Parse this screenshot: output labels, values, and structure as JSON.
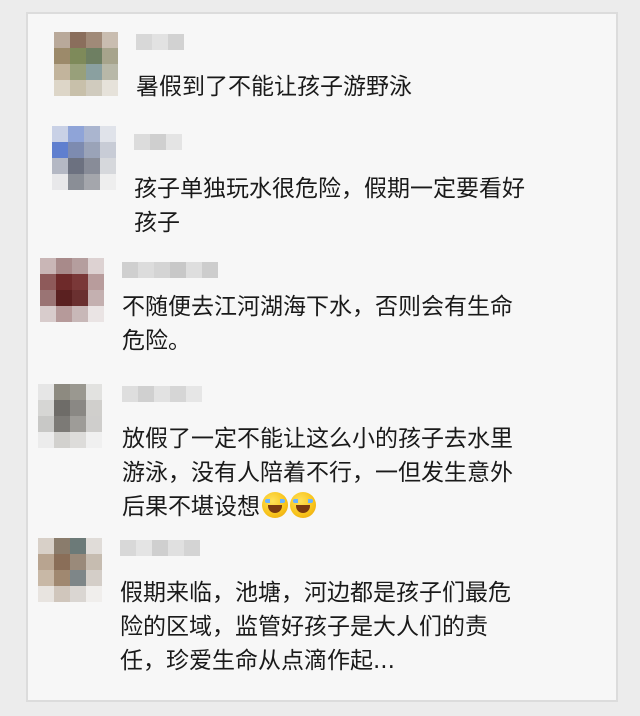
{
  "comments": [
    {
      "text": "暑假到了不能让孩子游野泳",
      "emoji_count": 0
    },
    {
      "text": "孩子单独玩水很危险，假期一定要看好\n孩子",
      "emoji_count": 0
    },
    {
      "text": "不随便去江河湖海下水，否则会有生命\n危险。",
      "emoji_count": 0
    },
    {
      "text": "放假了一定不能让这么小的孩子去水里\n游泳，没有人陪着不行，一但发生意外\n后果不堪设想",
      "emoji_count": 2,
      "emoji_icon": "rofl-face-icon"
    },
    {
      "text": "假期来临，池塘，河边都是孩子们最危\n险的区域，监管好孩子是大人们的责\n任，珍爱生命从点滴作起...",
      "emoji_count": 0
    }
  ],
  "colors": {
    "text": "#1a1a1a",
    "card_background": "#f7f7f7",
    "page_background": "#ececec"
  }
}
